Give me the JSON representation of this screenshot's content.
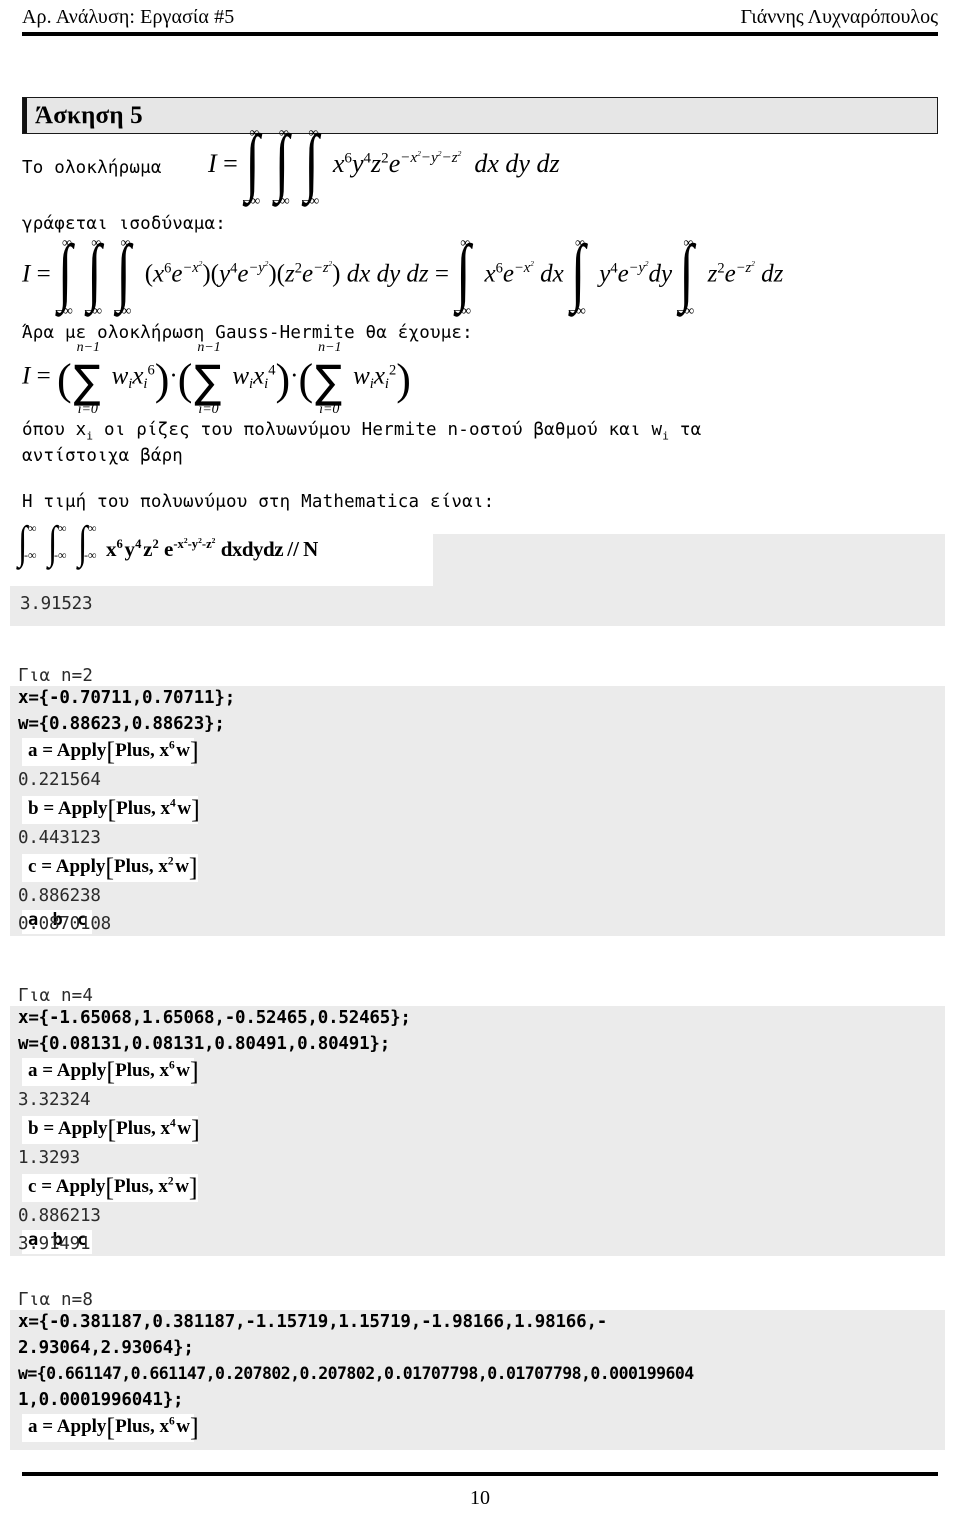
{
  "header": {
    "left": "Αρ. Ανάλυση: Εργασία #5",
    "right": "Γιάννης Λυχναρόπουλος"
  },
  "section": {
    "title": "Άσκηση 5"
  },
  "body": {
    "line_integral_intro": "Το ολοκλήρωμα",
    "line_equivalent": "γράφεται ισοδύναμα:",
    "line_gauss": "Άρα με ολοκλήρωση Gauss-Hermite θα έχουμε:",
    "line_where_1": "όπου x",
    "line_where_1b": " οι ρίζες του πολυωνύμου Hermite n-οστού βαθμού και w",
    "line_where_1c": " τα",
    "line_where_2": "αντίστοιχα βάρη",
    "line_mathematica": "Η τιμή του πολυωνύμου στη Mathematica είναι:"
  },
  "equations": {
    "eq1": {
      "lhs": "I =",
      "integrand": "x6 y4 z2 e^(−x²−y²−z²)",
      "diff": "dx dy dz",
      "upper_limit": "∞",
      "lower_limit": "−∞",
      "n_integrals": 3
    },
    "eq2": {
      "lhs": "I =",
      "factored": "(x6 e^−x²)(y4 e^−y²)(z2 e^−z²) dx dy dz",
      "equals": "=",
      "rhs": "∫ x6 e^−x² dx ∫ y4 e^−y² dy ∫ z2 e^−z² dz"
    },
    "eq3": {
      "lhs": "I =",
      "sum_upper": "n−1",
      "sum_lower": "i=0",
      "terms": [
        "w x 6",
        "w x 4",
        "w x 2"
      ],
      "operator": "·"
    }
  },
  "mathematica": {
    "first_cell": {
      "input": "∫∫∫ x6 y4 z2 e^(-x2-y2-z2) dxdydz // N",
      "input_suffix": "dxdydz // N",
      "output": "3.91523"
    },
    "blocks": [
      {
        "label": "Για n=2",
        "x_line": "x={-0.70711,0.70711};",
        "w_line": "w={0.88623,0.88623};",
        "steps": [
          {
            "var": "a",
            "fn": "Apply",
            "arg": "Plus, x",
            "exp": "6",
            "tail": "w",
            "result": "0.221564"
          },
          {
            "var": "b",
            "fn": "Apply",
            "arg": "Plus, x",
            "exp": "4",
            "tail": "w",
            "result": "0.443123"
          },
          {
            "var": "c",
            "fn": "Apply",
            "arg": "Plus, x",
            "exp": "2",
            "tail": "w",
            "result": "0.886238"
          }
        ],
        "product": "a b c",
        "product_result": "0.0870108"
      },
      {
        "label": "Για n=4",
        "x_line": "x={-1.65068,1.65068,-0.52465,0.52465};",
        "w_line": "w={0.08131,0.08131,0.80491,0.80491};",
        "steps": [
          {
            "var": "a",
            "fn": "Apply",
            "arg": "Plus, x",
            "exp": "6",
            "tail": "w",
            "result": "3.32324"
          },
          {
            "var": "b",
            "fn": "Apply",
            "arg": "Plus, x",
            "exp": "4",
            "tail": "w",
            "result": "1.3293"
          },
          {
            "var": "c",
            "fn": "Apply",
            "arg": "Plus, x",
            "exp": "2",
            "tail": "w",
            "result": "0.886213"
          }
        ],
        "product": "a b c",
        "product_result": "3.91491"
      },
      {
        "label": "Για n=8",
        "x_line_1": "x={-0.381187,0.381187,-1.15719,1.15719,-1.98166,1.98166,-",
        "x_line_2": "2.93064,2.93064};",
        "w_line_1": "w={0.661147,0.661147,0.207802,0.207802,0.01707798,0.01707798,0.000199604",
        "w_line_2": "1,0.0001996041};",
        "steps": [
          {
            "var": "a",
            "fn": "Apply",
            "arg": "Plus, x",
            "exp": "6",
            "tail": "w"
          }
        ]
      }
    ]
  },
  "footer": {
    "page_number": "10"
  },
  "colors": {
    "cell_background": "#ebebeb",
    "section_background": "#e6e6e6",
    "input_background": "#ffffff",
    "text": "#000000"
  }
}
